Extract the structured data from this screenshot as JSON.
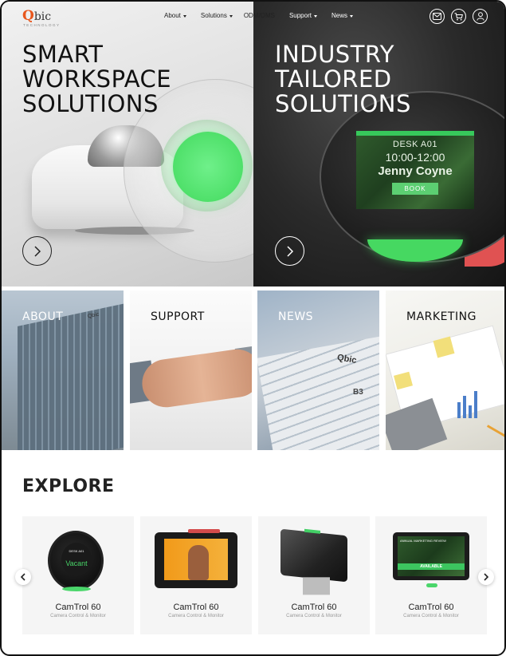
{
  "nav": {
    "logo_mark": "Q",
    "logo_text": "bic",
    "logo_tagline": "TECHNOLOGY",
    "links": [
      {
        "label": "About",
        "has_dropdown": true
      },
      {
        "label": "Solutions",
        "has_dropdown": true
      },
      {
        "label": "ODM/OMS",
        "has_dropdown": false
      },
      {
        "label": "Support",
        "has_dropdown": true
      },
      {
        "label": "News",
        "has_dropdown": true
      }
    ],
    "icons": [
      "mail-icon",
      "cart-icon",
      "user-icon"
    ]
  },
  "hero": {
    "left": {
      "line1": "SMART",
      "line2": "WORKSPACE",
      "line3": "SOLUTIONS"
    },
    "right": {
      "line1": "INDUSTRY",
      "line2": "TAILORED",
      "line3": "SOLUTIONS",
      "screen": {
        "room": "DESK A01",
        "time": "10:00-12:00",
        "person": "Jenny Coyne",
        "button": "BOOK"
      }
    }
  },
  "tiles": [
    {
      "label": "ABOUT"
    },
    {
      "label": "SUPPORT"
    },
    {
      "label": "NEWS"
    },
    {
      "label": "MARKETING"
    }
  ],
  "tile_art": {
    "about_sign": "Qbic",
    "news_logo": "Qbic",
    "news_tag": "B3"
  },
  "explore": {
    "title": "EXPLORE",
    "products": [
      {
        "name": "CamTrol 60",
        "subtitle": "Camera Control & Monitor",
        "screen_text": "Vacant",
        "screen_room": "DESK A01"
      },
      {
        "name": "CamTrol 60",
        "subtitle": "Camera Control & Monitor"
      },
      {
        "name": "CamTrol 60",
        "subtitle": "Camera Control & Monitor"
      },
      {
        "name": "CamTrol 60",
        "subtitle": "Camera Control & Monitor",
        "screen_title": "ANNUAL MARKETING REVIEW",
        "screen_status": "AVAILABLE"
      }
    ]
  },
  "colors": {
    "brand_orange": "#e8561c",
    "accent_green": "#46d861",
    "dark_bg": "#1a1a1a"
  }
}
